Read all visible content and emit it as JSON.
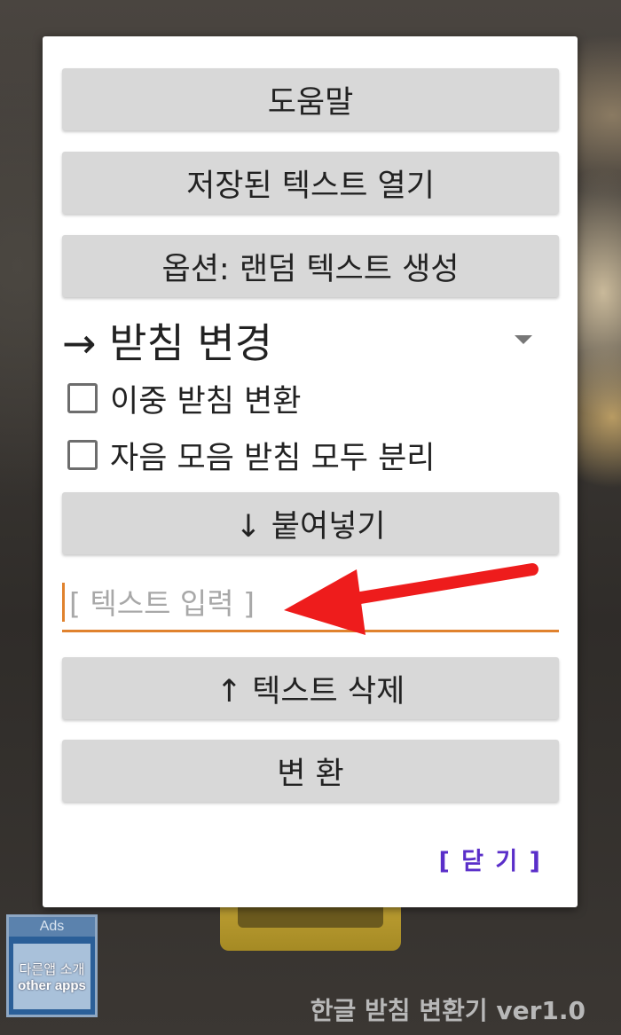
{
  "dialog": {
    "help_button": "도움말",
    "open_saved_button": "저장된 텍스트 열기",
    "random_option_button": "옵션: 랜덤 텍스트 생성",
    "mode_spinner": "→ 받침 변경",
    "checkbox_double": "이중 받침 변환",
    "checkbox_split_all": "자음 모음 받침 모두 분리",
    "paste_button": "↓ 붙여넣기",
    "text_input": {
      "placeholder": "[ 텍스트 입력 ]",
      "value": ""
    },
    "delete_text_button": "↑ 텍스트 삭제",
    "convert_button": "변 환",
    "close_link": "[ 닫 기 ]"
  },
  "ads": {
    "tag": "Ads",
    "line1": "다른앱 소개",
    "line2": "other apps"
  },
  "footer": {
    "app_title": "한글 받침 변환기 ver1.0"
  },
  "colors": {
    "accent_underline": "#e0822e",
    "annotation_arrow": "#ee1c1c",
    "close_link": "#5a2ec9"
  }
}
